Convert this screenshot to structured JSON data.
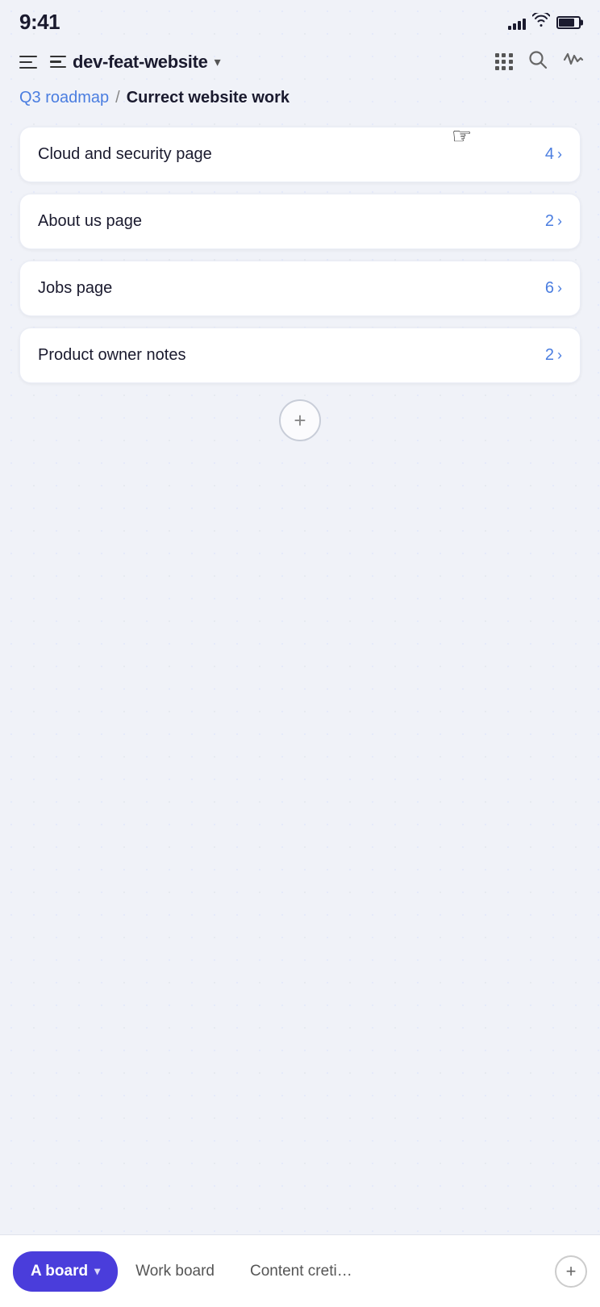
{
  "status_bar": {
    "time": "9:41",
    "signal_bars": [
      4,
      6,
      9,
      12,
      15
    ],
    "wifi": "wifi",
    "battery_level": 80
  },
  "toolbar": {
    "hamburger_label": "menu",
    "list_icon_label": "list-view",
    "project_name": "dev-feat-website",
    "chevron": "▾",
    "grid_icon": "grid",
    "search_icon": "search",
    "activity_icon": "activity"
  },
  "breadcrumb": {
    "parent_label": "Q3 roadmap",
    "separator": "/",
    "current_label": "Currect website work"
  },
  "list_items": [
    {
      "name": "Cloud and security page",
      "count": "4",
      "id": "cloud-security"
    },
    {
      "name": "About us page",
      "count": "2",
      "id": "about-us"
    },
    {
      "name": "Jobs page",
      "count": "6",
      "id": "jobs"
    },
    {
      "name": "Product owner notes",
      "count": "2",
      "id": "product-owner-notes"
    }
  ],
  "add_button": {
    "label": "+"
  },
  "bottom_bar": {
    "active_tab": "A board",
    "active_tab_chevron": "▾",
    "tabs": [
      {
        "label": "Work board",
        "id": "work-board"
      },
      {
        "label": "Content cretion pi",
        "id": "content-creation"
      }
    ],
    "add_label": "+"
  }
}
